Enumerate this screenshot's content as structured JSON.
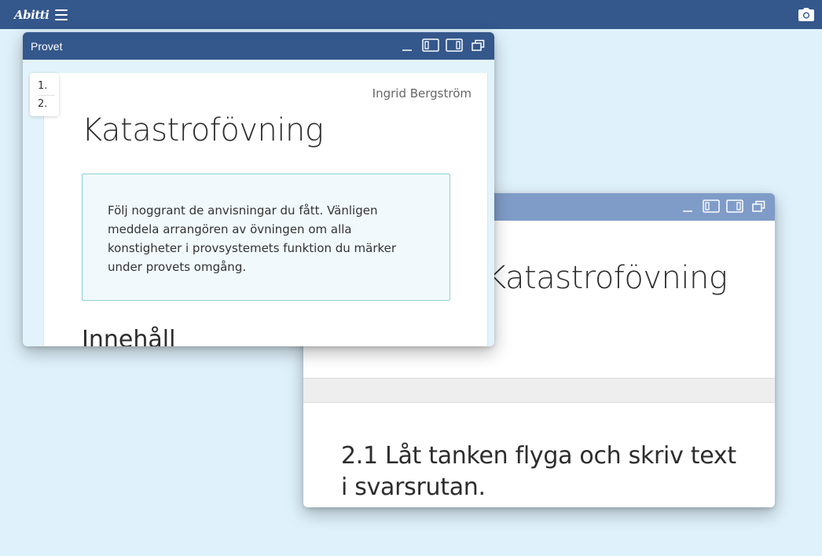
{
  "topbar": {
    "logo_text": "Abitti",
    "menu_icon": "hamburger-menu-icon",
    "camera_icon": "camera-icon",
    "background": "#34578c"
  },
  "front_window": {
    "title": "Provet",
    "titlebar_color": "#34578c",
    "toc": [
      "1.",
      "2."
    ],
    "author": "Ingrid Bergström",
    "heading": "Katastrofövning",
    "instructions": "Följ noggrant de anvisningar du fått. Vänligen meddela arrangören av övningen om alla konstigheter i provsystemets funktion du märker under provets omgång.",
    "contents_heading": "Innehåll"
  },
  "back_window": {
    "title": "",
    "titlebar_color": "#7f9cc8",
    "heading": "Katastrofövning",
    "question": "2.1 Låt tanken flyga och skriv text i svarsrutan."
  },
  "window_controls": [
    "minimize-icon",
    "dock-left-icon",
    "dock-right-icon",
    "restore-icon"
  ]
}
